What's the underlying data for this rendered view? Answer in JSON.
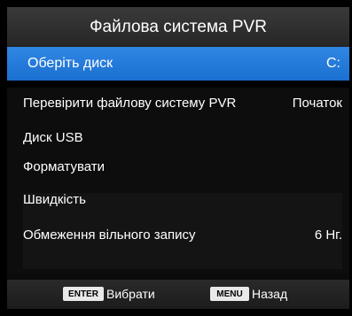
{
  "title": "Файлова система PVR",
  "selected_item": {
    "label": "Оберіть диск",
    "value": "C:"
  },
  "items": [
    {
      "label": "Перевірити файлову систему PVR",
      "value": "Початок"
    },
    {
      "label": "Диск USB",
      "value": ""
    },
    {
      "label": "Форматувати",
      "value": ""
    },
    {
      "label": "Швидкість",
      "value": ""
    },
    {
      "label": "Обмеження вільного запису",
      "value": "6 Нг."
    }
  ],
  "footer": {
    "enter_key": "ENTER",
    "enter_label": "Вибрати",
    "menu_key": "MENU",
    "menu_label": "Назад"
  },
  "colors": {
    "highlight": "#2f87e3",
    "background": "#000000",
    "text": "#ffffff"
  }
}
